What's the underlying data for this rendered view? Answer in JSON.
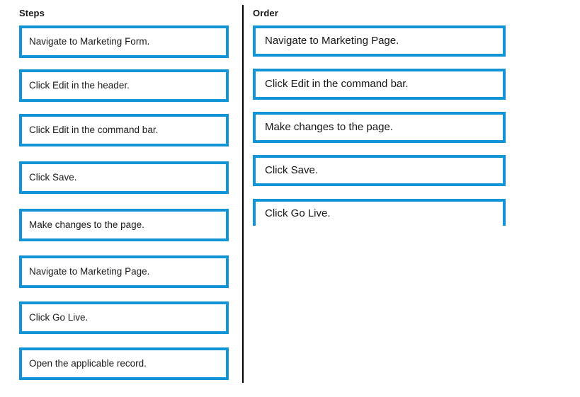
{
  "columns": {
    "steps": {
      "header": "Steps",
      "items": [
        {
          "label": "Navigate to Marketing Form."
        },
        {
          "label": "Click Edit in the header."
        },
        {
          "label": "Click Edit in the command bar."
        },
        {
          "label": "Click Save."
        },
        {
          "label": "Make changes to the page."
        },
        {
          "label": "Navigate to Marketing Page."
        },
        {
          "label": "Click Go Live."
        },
        {
          "label": "Open the applicable record."
        }
      ]
    },
    "order": {
      "header": "Order",
      "items": [
        {
          "label": "Navigate to Marketing Page."
        },
        {
          "label": "Click Edit in the command bar."
        },
        {
          "label": "Make changes to the page."
        },
        {
          "label": "Click Save."
        },
        {
          "label": "Click Go Live."
        }
      ]
    }
  },
  "colors": {
    "card_border": "#1195D6",
    "card_fill": "#FFFFFF",
    "text": "#1A1A1A",
    "header_text": "#161616",
    "divider": "#000000",
    "background": "#FFFFFF"
  }
}
